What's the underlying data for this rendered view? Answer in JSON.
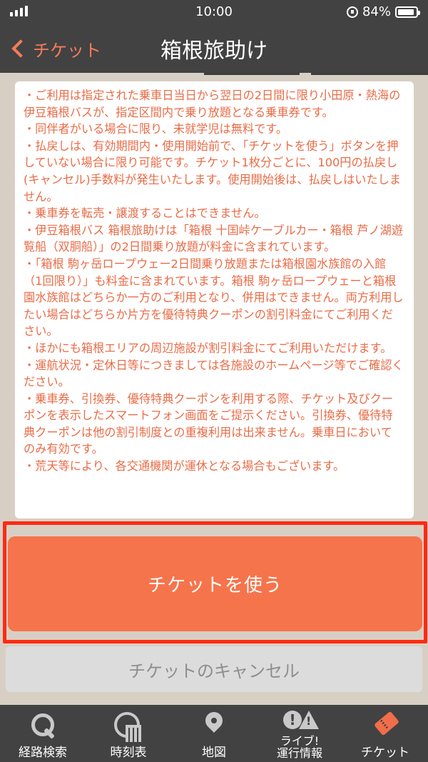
{
  "status_bar": {
    "time": "10:00",
    "battery": "84%"
  },
  "header": {
    "back_label": "チケット",
    "title": "箱根旅助け"
  },
  "terms": [
    "・ご利用は指定された乗車日当日から翌日の2日間に限り小田原・熱海の伊豆箱根バスが、指定区間内で乗り放題となる乗車券です。",
    "・同伴者がいる場合に限り、未就学児は無料です。",
    "・払戻しは、有効期間内・使用開始前で、「チケットを使う」ボタンを押していない場合に限り可能です。チケット1枚分ごとに、100円の払戻し(キャンセル)手数料が発生いたします。使用開始後は、払戻しはいたしません。",
    "・乗車券を転売・譲渡することはできません。",
    "・伊豆箱根バス 箱根旅助けは「箱根 十国峠ケーブルカー・箱根 芦ノ湖遊覧船（双胴船）」の2日間乗り放題が料金に含まれています。",
    "・「箱根 駒ヶ岳ロープウェー2日間乗り放題または箱根園水族館の入館（1回限り）」も料金に含まれています。箱根 駒ヶ岳ロープウェーと箱根園水族館はどちらか一方のご利用となり、併用はできません。両方利用したい場合はどちらか片方を優待特典クーポンの割引料金にてご利用ください。",
    "・ほかにも箱根エリアの周辺施設が割引料金にてご利用いただけます。",
    "・運航状況・定休日等につきましては各施設のホームページ等でご確認ください。",
    "・乗車券、引換券、優待特典クーポンを利用する際、チケット及びクーポンを表示したスマートフォン画面をご提示ください。引換券、優待特典クーポンは他の割引制度との重複利用は出来ません。乗車日においてのみ有効です。",
    "・荒天等により、各交通機関が運休となる場合もございます。"
  ],
  "buttons": {
    "use": "チケットを使う",
    "cancel": "チケットのキャンセル"
  },
  "tabs": [
    {
      "label": "経路検索",
      "icon": "search-icon"
    },
    {
      "label": "時刻表",
      "icon": "timetable-icon"
    },
    {
      "label": "地図",
      "icon": "map-pin-icon"
    },
    {
      "label_line1": "ライブ!",
      "label_line2": "運行情報",
      "icon": "live-alert-icon"
    },
    {
      "label": "チケット",
      "icon": "ticket-icon"
    }
  ],
  "colors": {
    "accent": "#f5744c",
    "highlight_frame": "#ff2a12",
    "bar": "#424242",
    "terms_text": "#e96c48"
  }
}
